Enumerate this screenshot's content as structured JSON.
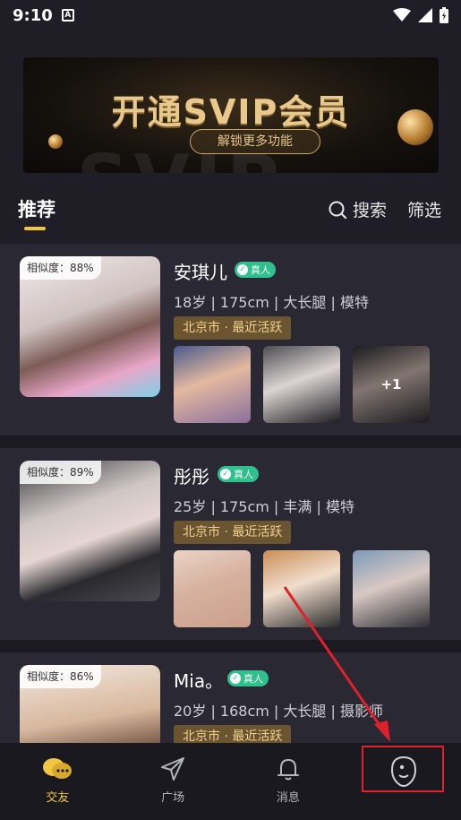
{
  "status_bar": {
    "time": "9:10",
    "a_label": "A"
  },
  "banner": {
    "title": "开通SVIP会员",
    "subtitle": "解锁更多功能",
    "bg_text": "SVIP"
  },
  "tabs": {
    "recommend": "推荐",
    "search": "搜索",
    "filter": "筛选"
  },
  "cards": [
    {
      "similarity": "相似度：88%",
      "name": "安琪儿",
      "verified": "真人",
      "info": "18岁 | 175cm | 大长腿 | 模特",
      "location": "北京市 · 最近活跃",
      "more_count": "+1"
    },
    {
      "similarity": "相似度：89%",
      "name": "彤彤",
      "verified": "真人",
      "info": "25岁 | 175cm | 丰满 | 模特",
      "location": "北京市 · 最近活跃"
    },
    {
      "similarity": "相似度：86%",
      "name": "Mia。",
      "verified": "真人",
      "info": "20岁 | 168cm | 大长腿 | 摄影师",
      "location": "北京市 · 最近活跃"
    }
  ],
  "bottom_nav": [
    {
      "label": "交友",
      "icon": "chat-bubbles-icon",
      "active": true
    },
    {
      "label": "广场",
      "icon": "paper-plane-icon",
      "active": false
    },
    {
      "label": "消息",
      "icon": "bell-icon",
      "active": false
    },
    {
      "label": "",
      "icon": "profile-icon",
      "active": false
    }
  ],
  "colors": {
    "accent": "#f2c641",
    "verified": "#2fc08e",
    "highlight_box": "#e0212b"
  }
}
